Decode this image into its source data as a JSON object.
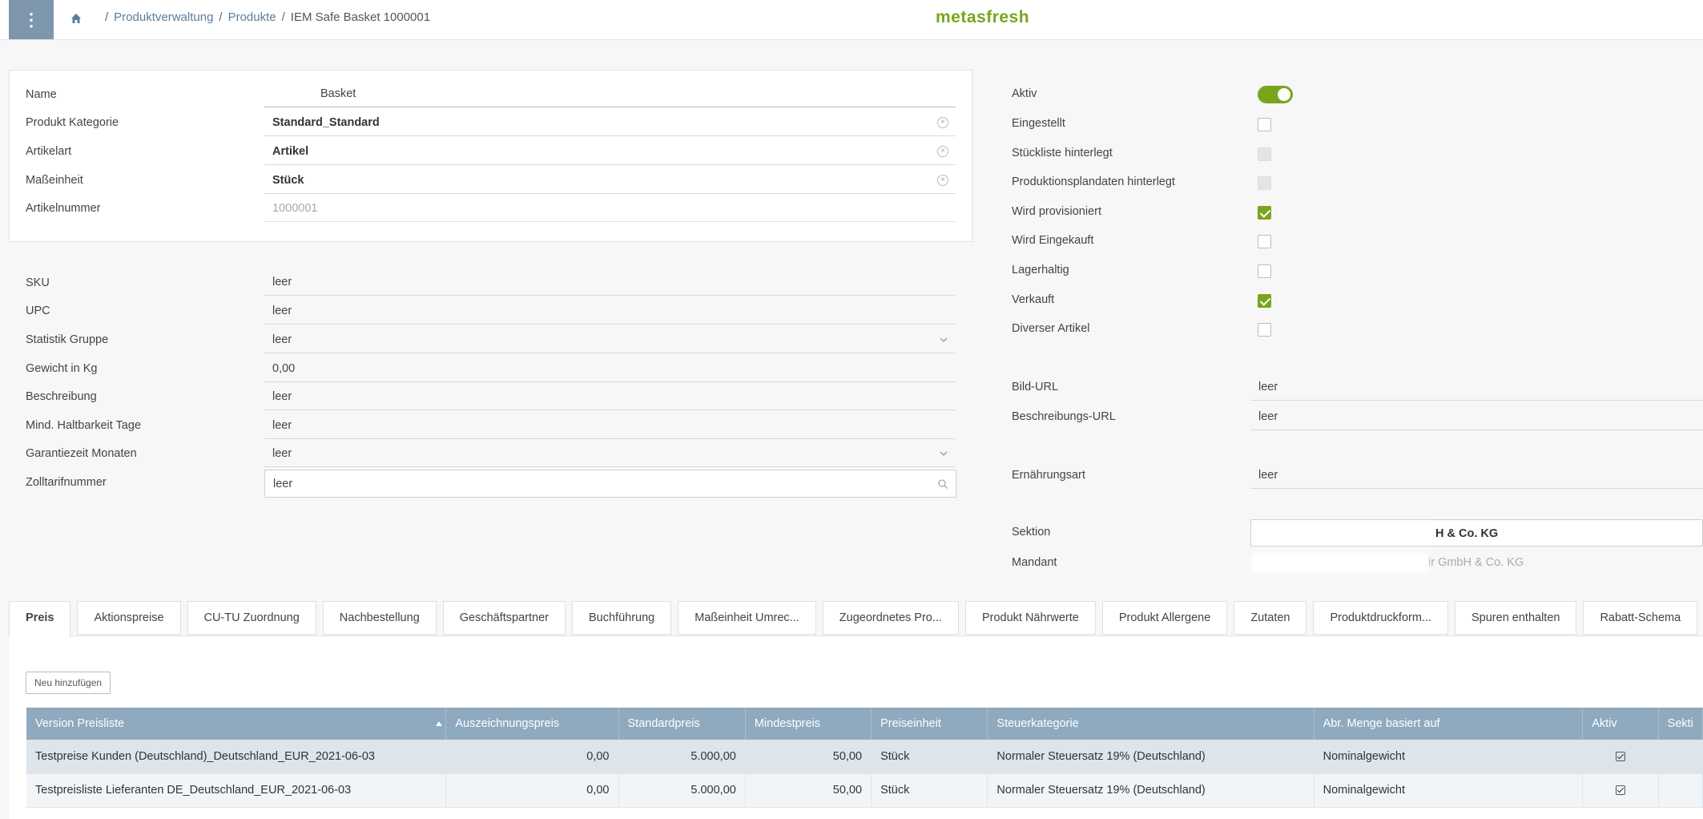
{
  "header": {
    "breadcrumb": [
      "Produktverwaltung",
      "Produkte",
      "IEM Safe Basket 1000001"
    ],
    "logo": "metasfresh",
    "menu_glyph": "⋮"
  },
  "main_fields": {
    "name_label": "Name",
    "name_value": "Basket",
    "kategorie_label": "Produkt Kategorie",
    "kategorie_value": "Standard_Standard",
    "artikelart_label": "Artikelart",
    "artikelart_value": "Artikel",
    "masseinheit_label": "Maßeinheit",
    "masseinheit_value": "Stück",
    "artikelnummer_label": "Artikelnummer",
    "artikelnummer_value": "1000001"
  },
  "detail_fields": {
    "sku_label": "SKU",
    "sku_value": "leer",
    "upc_label": "UPC",
    "upc_value": "leer",
    "statistik_label": "Statistik Gruppe",
    "statistik_value": "leer",
    "gewicht_label": "Gewicht in Kg",
    "gewicht_value": "0,00",
    "beschreibung_label": "Beschreibung",
    "beschreibung_value": "leer",
    "haltbarkeit_label": "Mind. Haltbarkeit Tage",
    "haltbarkeit_value": "leer",
    "garantie_label": "Garantiezeit Monaten",
    "garantie_value": "leer",
    "zoll_label": "Zolltarifnummer",
    "zoll_value": "leer"
  },
  "flags": {
    "aktiv_label": "Aktiv",
    "eingestellt_label": "Eingestellt",
    "stueckliste_label": "Stückliste hinterlegt",
    "produktionsplan_label": "Produktionsplandaten hinterlegt",
    "provisioniert_label": "Wird provisioniert",
    "eingekauft_label": "Wird Eingekauft",
    "lagerhaltig_label": "Lagerhaltig",
    "verkauft_label": "Verkauft",
    "divers_label": "Diverser Artikel"
  },
  "right_fields": {
    "bildurl_label": "Bild-URL",
    "bildurl_value": "leer",
    "beschrurl_label": "Beschreibungs-URL",
    "beschrurl_value": "leer",
    "ernaehrung_label": "Ernährungsart",
    "ernaehrung_value": "leer",
    "sektion_label": "Sektion",
    "sektion_value": "H & Co. KG",
    "mandant_label": "Mandant",
    "mandant_value": "ir GmbH & Co. KG"
  },
  "tabs": [
    "Preis",
    "Aktionspreise",
    "CU-TU Zuordnung",
    "Nachbestellung",
    "Geschäftspartner",
    "Buchführung",
    "Maßeinheit Umrec...",
    "Zugeordnetes Pro...",
    "Produkt Nährwerte",
    "Produkt Allergene",
    "Zutaten",
    "Produktdruckform...",
    "Spuren enthalten",
    "Rabatt-Schema"
  ],
  "new_button": "Neu hinzufügen",
  "table": {
    "columns": [
      "Version Preisliste",
      "Auszeichnungspreis",
      "Standardpreis",
      "Mindestpreis",
      "Preiseinheit",
      "Steuerkategorie",
      "Abr. Menge basiert auf",
      "Aktiv",
      "Sekti"
    ],
    "rows": [
      [
        "Testpreise Kunden (Deutschland)_Deutschland_EUR_2021-06-03",
        "0,00",
        "5.000,00",
        "50,00",
        "Stück",
        "Normaler Steuersatz 19% (Deutschland)",
        "Nominalgewicht"
      ],
      [
        "Testpreisliste Lieferanten DE_Deutschland_EUR_2021-06-03",
        "0,00",
        "5.000,00",
        "50,00",
        "Stück",
        "Normaler Steuersatz 19% (Deutschland)",
        "Nominalgewicht"
      ]
    ]
  },
  "colors": {
    "accent": "#78a51d",
    "menu": "#7d96ad",
    "table_header": "#8fa9bf",
    "link": "#5b7d9c"
  },
  "icons": [
    "menu-dots-icon",
    "home-icon",
    "clear-icon",
    "chevron-down-icon",
    "search-icon",
    "sort-asc-icon",
    "check-icon"
  ]
}
